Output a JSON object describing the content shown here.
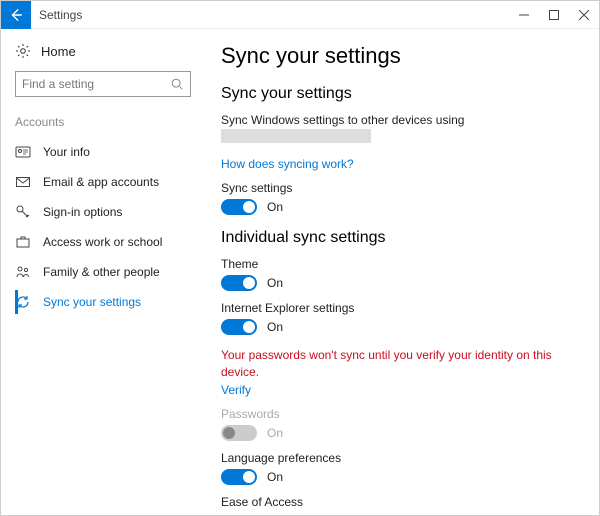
{
  "titlebar": {
    "title": "Settings"
  },
  "sidebar": {
    "home": "Home",
    "search_placeholder": "Find a setting",
    "section": "Accounts",
    "items": [
      {
        "label": "Your info"
      },
      {
        "label": "Email & app accounts"
      },
      {
        "label": "Sign-in options"
      },
      {
        "label": "Access work or school"
      },
      {
        "label": "Family & other people"
      },
      {
        "label": "Sync your settings"
      }
    ]
  },
  "content": {
    "page_title": "Sync your settings",
    "section1_title": "Sync your settings",
    "sync_desc": "Sync Windows settings to other devices using",
    "how_link": "How does syncing work?",
    "sync_settings_label": "Sync settings",
    "on": "On",
    "section2_title": "Individual sync settings",
    "theme_label": "Theme",
    "ie_label": "Internet Explorer settings",
    "error_text": "Your passwords won't sync until you verify your identity on this device.",
    "verify_link": "Verify",
    "passwords_label": "Passwords",
    "lang_label": "Language preferences",
    "ease_label": "Ease of Access"
  }
}
